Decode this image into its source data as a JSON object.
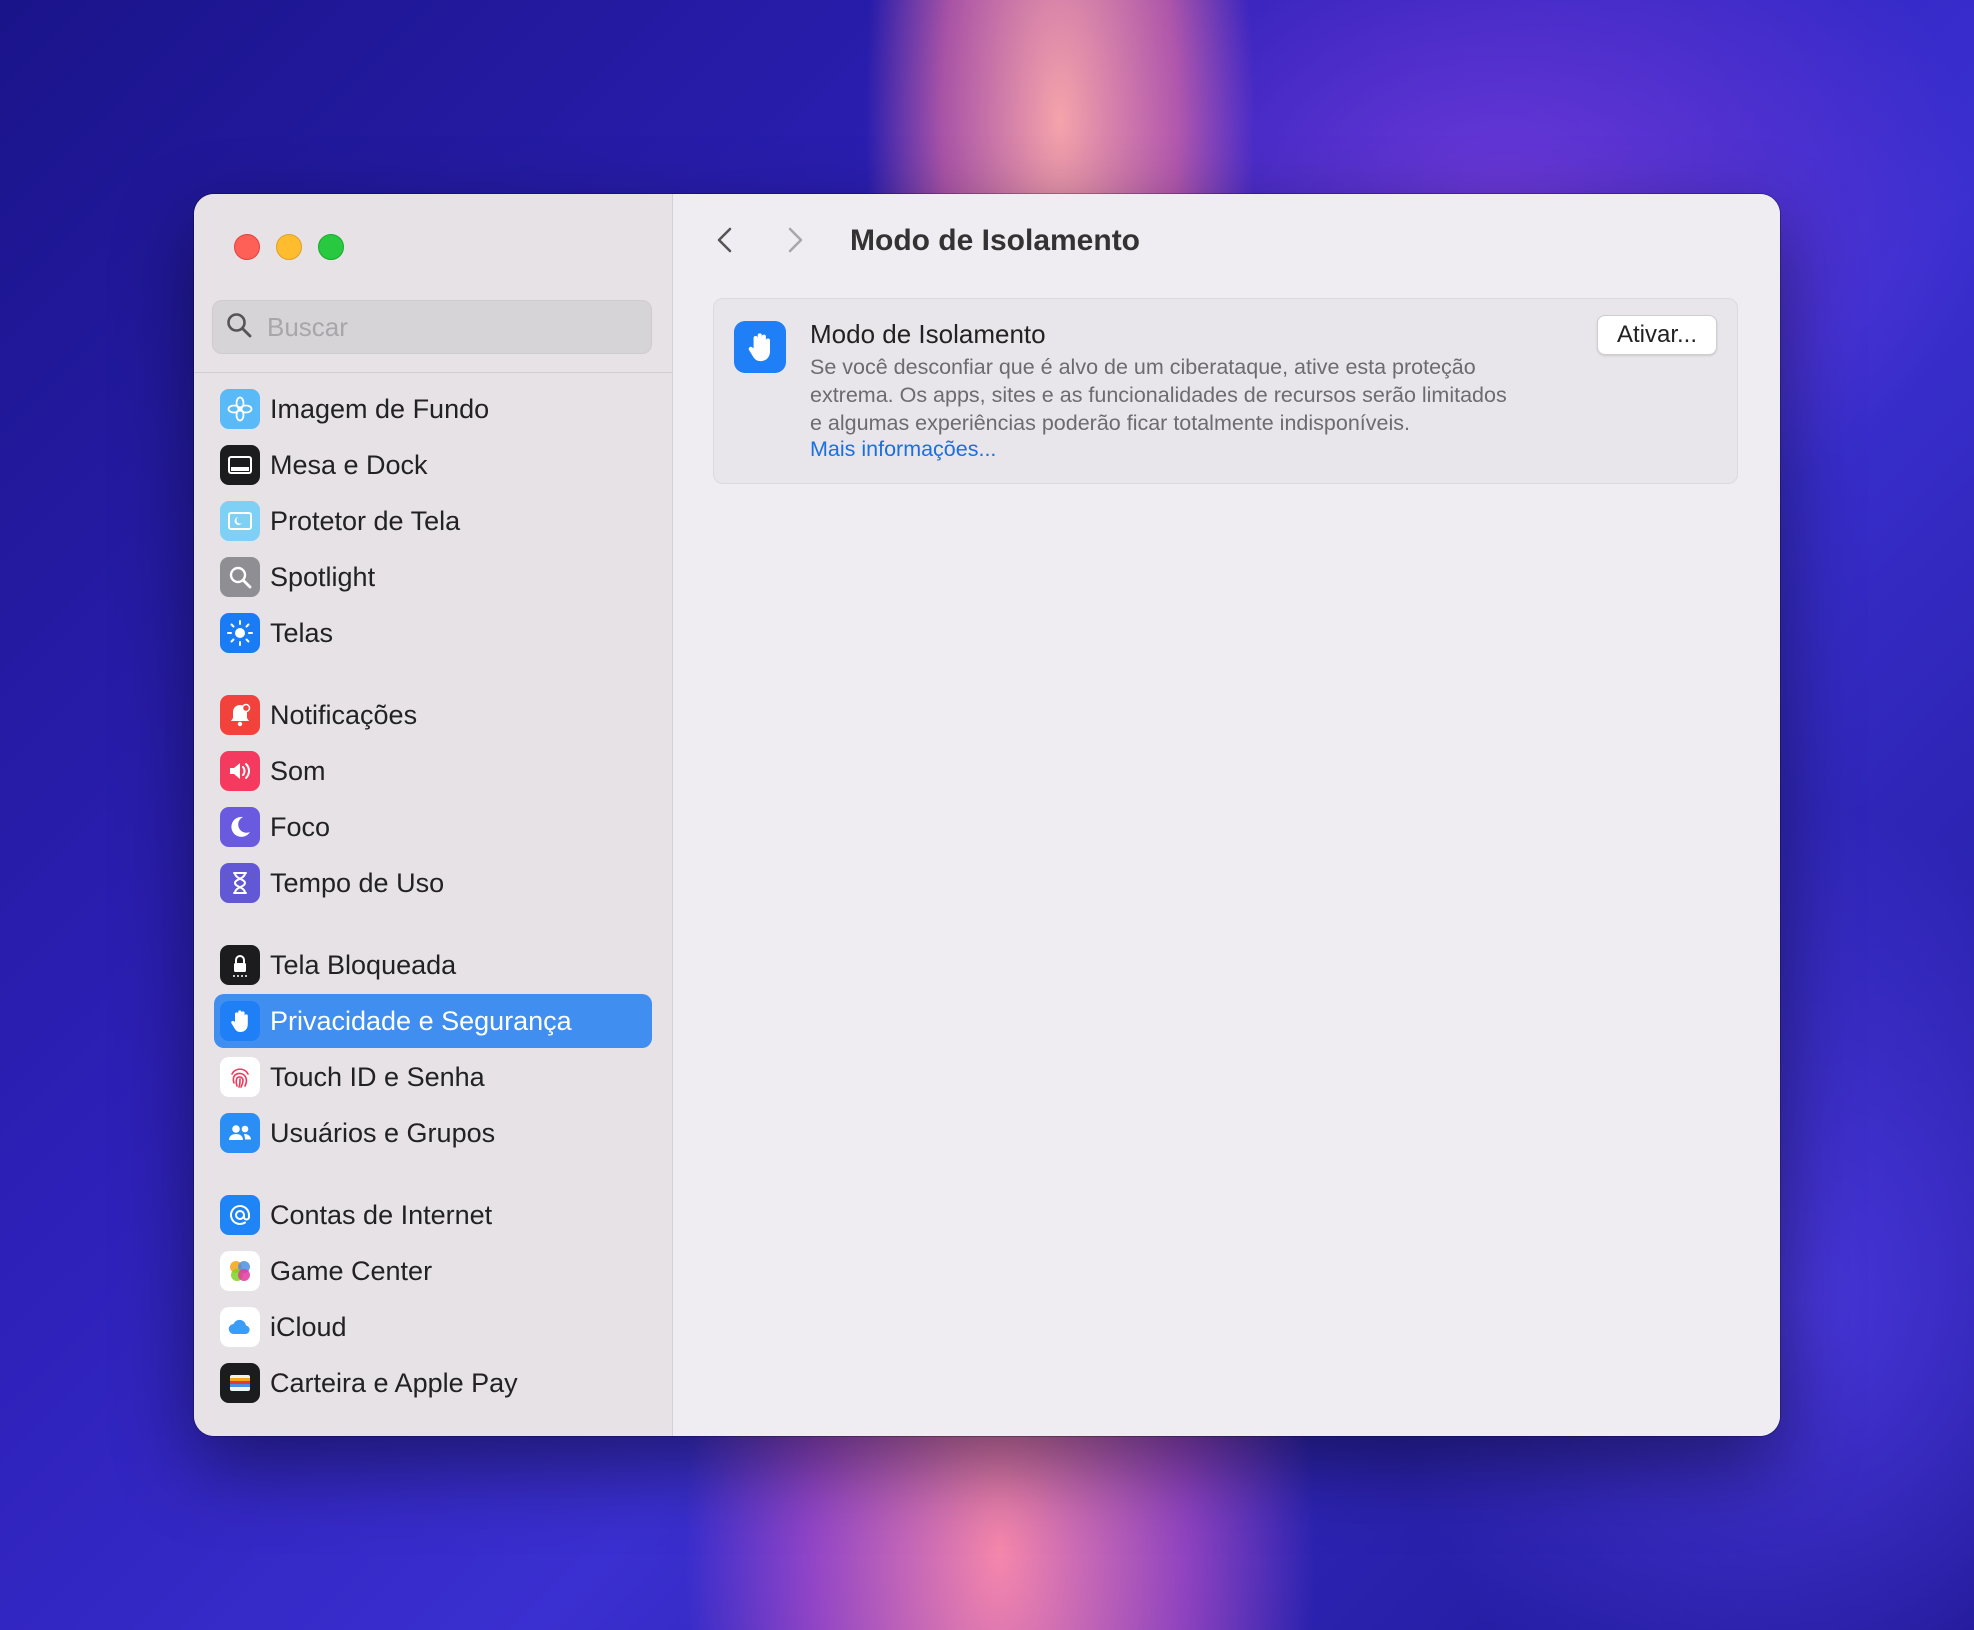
{
  "window": {
    "traffic_lights": [
      "close",
      "minimize",
      "zoom"
    ]
  },
  "sidebar": {
    "search": {
      "placeholder": "Buscar",
      "value": ""
    },
    "items": [
      {
        "label": "Imagem de Fundo",
        "icon": "wallpaper-flower-icon"
      },
      {
        "label": "Mesa e Dock",
        "icon": "desktop-dock-icon"
      },
      {
        "label": "Protetor de Tela",
        "icon": "screensaver-icon"
      },
      {
        "label": "Spotlight",
        "icon": "spotlight-magnifier-icon"
      },
      {
        "label": "Telas",
        "icon": "displays-sun-icon"
      },
      {
        "label": "Notificações",
        "icon": "notifications-bell-icon"
      },
      {
        "label": "Som",
        "icon": "sound-speaker-icon"
      },
      {
        "label": "Foco",
        "icon": "focus-moon-icon"
      },
      {
        "label": "Tempo de Uso",
        "icon": "screen-time-hourglass-icon"
      },
      {
        "label": "Tela Bloqueada",
        "icon": "lock-screen-icon"
      },
      {
        "label": "Privacidade e Segurança",
        "icon": "privacy-hand-icon",
        "selected": true
      },
      {
        "label": "Touch ID e Senha",
        "icon": "fingerprint-icon"
      },
      {
        "label": "Usuários e Grupos",
        "icon": "users-groups-icon"
      },
      {
        "label": "Contas de Internet",
        "icon": "at-sign-icon"
      },
      {
        "label": "Game Center",
        "icon": "game-center-icon"
      },
      {
        "label": "iCloud",
        "icon": "icloud-icon"
      },
      {
        "label": "Carteira e Apple Pay",
        "icon": "wallet-icon"
      }
    ]
  },
  "main": {
    "title": "Modo de Isolamento",
    "card": {
      "title": "Modo de Isolamento",
      "description_lines": [
        "Se você desconfiar que é alvo de um ciberataque, ative esta proteção",
        "extrema. Os apps, sites e as funcionalidades de recursos serão limitados",
        "e algumas experiências poderão ficar totalmente indisponíveis."
      ],
      "link": "Mais informações...",
      "button": "Ativar...",
      "icon": "hand-raised-icon"
    }
  },
  "colors": {
    "accent": "#3f8ef0",
    "link": "#1b6fe0",
    "sidebar_bg": "#e6e2e6",
    "content_bg": "#efedf2"
  }
}
